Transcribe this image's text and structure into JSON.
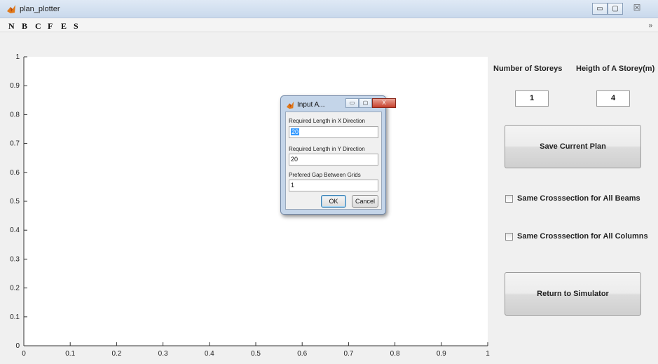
{
  "window": {
    "title": "plan_plotter",
    "minimize_label": "▭",
    "maximize_label": "▢",
    "close_label": "☒"
  },
  "menu": {
    "items": [
      "N",
      "B",
      "C",
      "F",
      "E",
      "S"
    ],
    "overflow": "»"
  },
  "plot": {
    "x_ticks": [
      "0",
      "0.1",
      "0.2",
      "0.3",
      "0.4",
      "0.5",
      "0.6",
      "0.7",
      "0.8",
      "0.9",
      "1"
    ],
    "y_ticks": [
      "0",
      "0.1",
      "0.2",
      "0.3",
      "0.4",
      "0.5",
      "0.6",
      "0.7",
      "0.8",
      "0.9",
      "1"
    ],
    "xlim": [
      0,
      1
    ],
    "ylim": [
      0,
      1
    ]
  },
  "panel": {
    "storeys_label": "Number of Storeys",
    "height_label": "Heigth of A Storey(m)",
    "storeys_value": "1",
    "height_value": "4",
    "save_label": "Save Current Plan",
    "beams_label": "Same Crosssection for All Beams",
    "columns_label": "Same Crosssection for All Columns",
    "return_label": "Return to Simulator"
  },
  "dialog": {
    "title": "Input A...",
    "minimize_label": "▭",
    "maximize_label": "▢",
    "close_label": "X",
    "x_label": "Required Length in X Direction",
    "x_value": "20",
    "y_label": "Required Length in Y Direction",
    "y_value": "20",
    "gap_label": "Prefered Gap Between Grids",
    "gap_value": "1",
    "ok_label": "OK",
    "cancel_label": "Cancel"
  },
  "colors": {
    "plot_bg": "#ffffff",
    "window_bg": "#f0f0f0",
    "selection": "#3399ff"
  }
}
